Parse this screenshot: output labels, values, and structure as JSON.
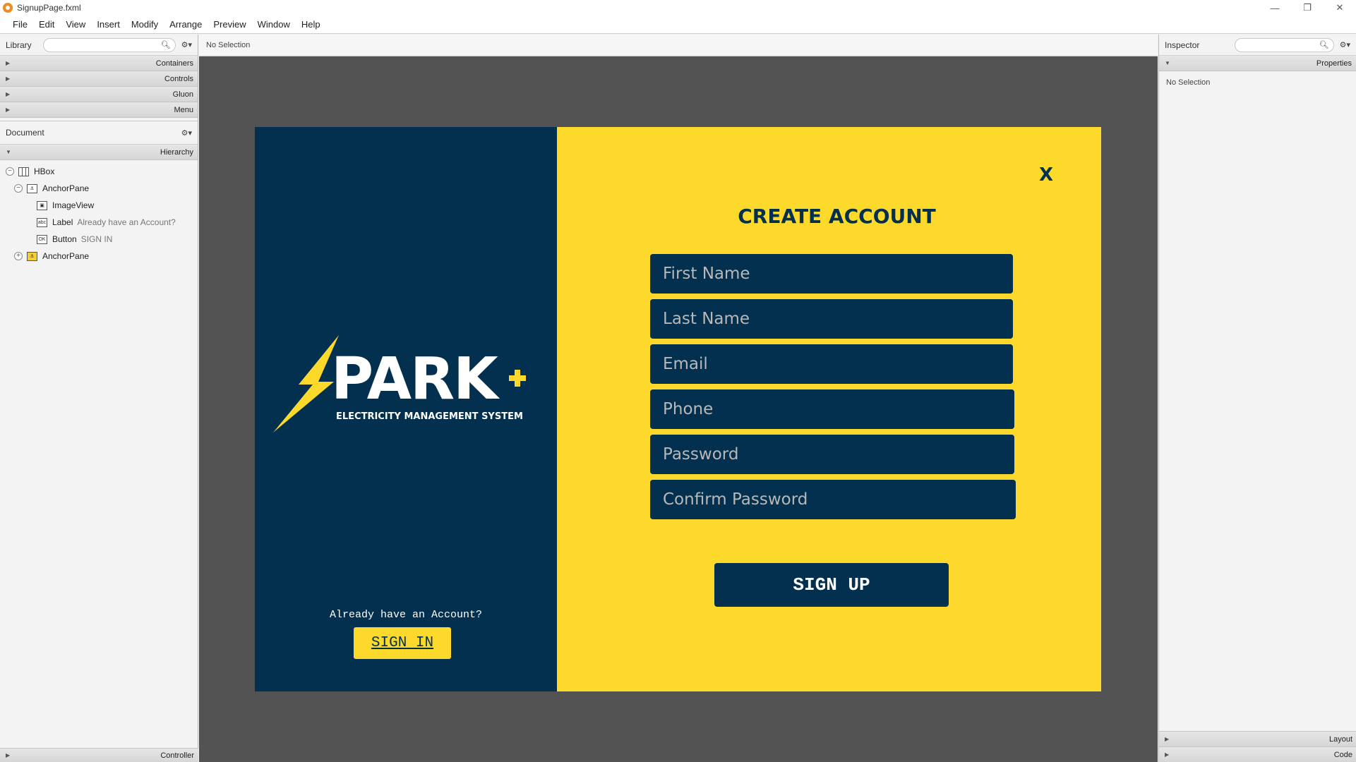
{
  "window": {
    "title": "SignupPage.fxml",
    "minimize": "—",
    "restore": "❐",
    "close": "✕"
  },
  "menu": [
    "File",
    "Edit",
    "View",
    "Insert",
    "Modify",
    "Arrange",
    "Preview",
    "Window",
    "Help"
  ],
  "library": {
    "title": "Library",
    "sections": [
      "Containers",
      "Controls",
      "Gluon",
      "Menu"
    ]
  },
  "document": {
    "title": "Document",
    "hierarchy_label": "Hierarchy",
    "tree": [
      {
        "type": "HBox",
        "detail": ""
      },
      {
        "type": "AnchorPane",
        "detail": ""
      },
      {
        "type": "ImageView",
        "detail": ""
      },
      {
        "type": "Label",
        "detail": "Already have an Account?"
      },
      {
        "type": "Button",
        "detail": "SIGN IN"
      },
      {
        "type": "AnchorPane",
        "detail": ""
      }
    ],
    "controller_label": "Controller"
  },
  "center": {
    "selection_status": "No Selection"
  },
  "preview": {
    "logo_word": "PARK",
    "logo_tagline": "ELECTRICITY MANAGEMENT SYSTEM",
    "already_label": "Already have an Account?",
    "signin_label": "SIGN IN",
    "close_label": "X",
    "title": "CREATE ACCOUNT",
    "fields": {
      "first_name": "First Name",
      "last_name": "Last Name",
      "email": "Email",
      "phone": "Phone",
      "password": "Password",
      "confirm_password": "Confirm Password"
    },
    "signup_label": "SIGN UP",
    "colors": {
      "navy": "#02304e",
      "yellow": "#fdd92b"
    }
  },
  "inspector": {
    "title": "Inspector",
    "properties_label": "Properties",
    "status": "No Selection",
    "layout_label": "Layout",
    "code_label": "Code"
  }
}
